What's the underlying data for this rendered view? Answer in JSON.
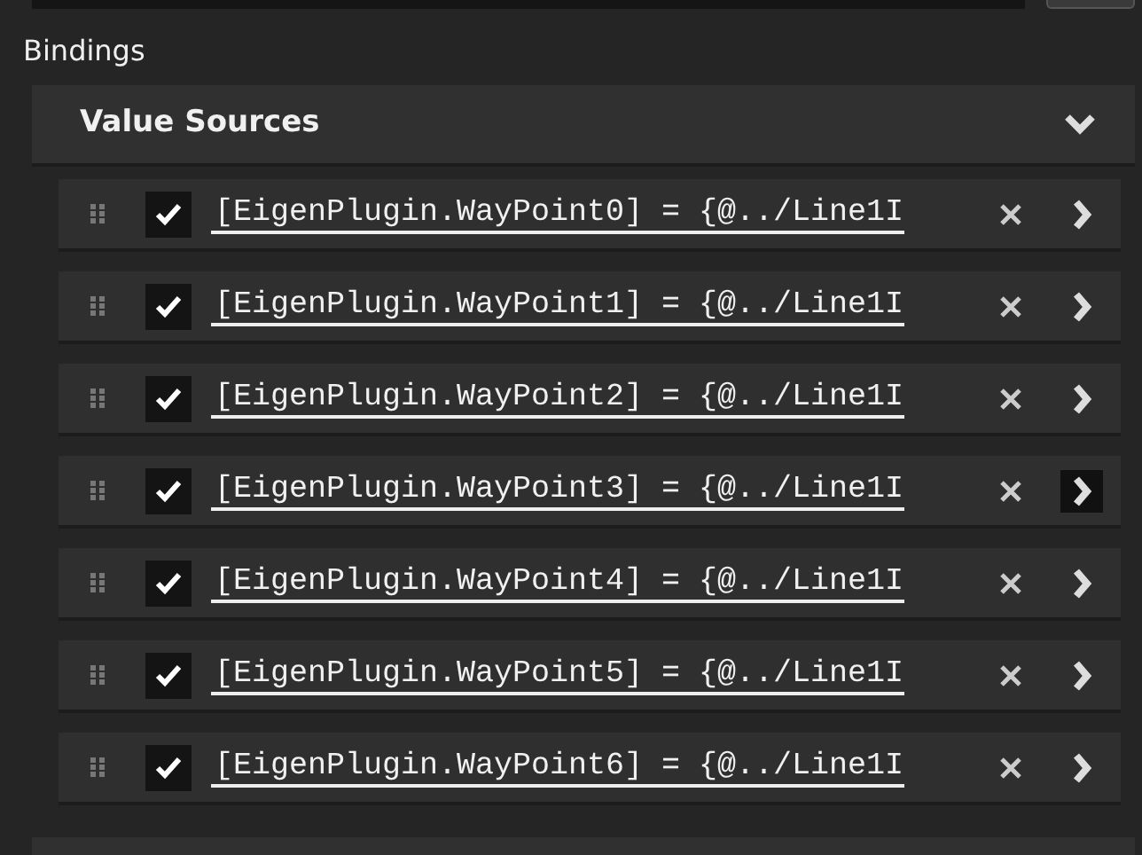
{
  "section_title": "Bindings",
  "panel": {
    "title": "Value Sources",
    "expanded": true,
    "items": [
      {
        "expression": "[EigenPlugin.WayPoint0] = {@../Line1I",
        "checked": true,
        "highlighted": false
      },
      {
        "expression": "[EigenPlugin.WayPoint1] = {@../Line1I",
        "checked": true,
        "highlighted": false
      },
      {
        "expression": "[EigenPlugin.WayPoint2] = {@../Line1I",
        "checked": true,
        "highlighted": false
      },
      {
        "expression": "[EigenPlugin.WayPoint3] = {@../Line1I",
        "checked": true,
        "highlighted": true
      },
      {
        "expression": "[EigenPlugin.WayPoint4] = {@../Line1I",
        "checked": true,
        "highlighted": false
      },
      {
        "expression": "[EigenPlugin.WayPoint5] = {@../Line1I",
        "checked": true,
        "highlighted": false
      },
      {
        "expression": "[EigenPlugin.WayPoint6] = {@../Line1I",
        "checked": true,
        "highlighted": false
      }
    ]
  }
}
